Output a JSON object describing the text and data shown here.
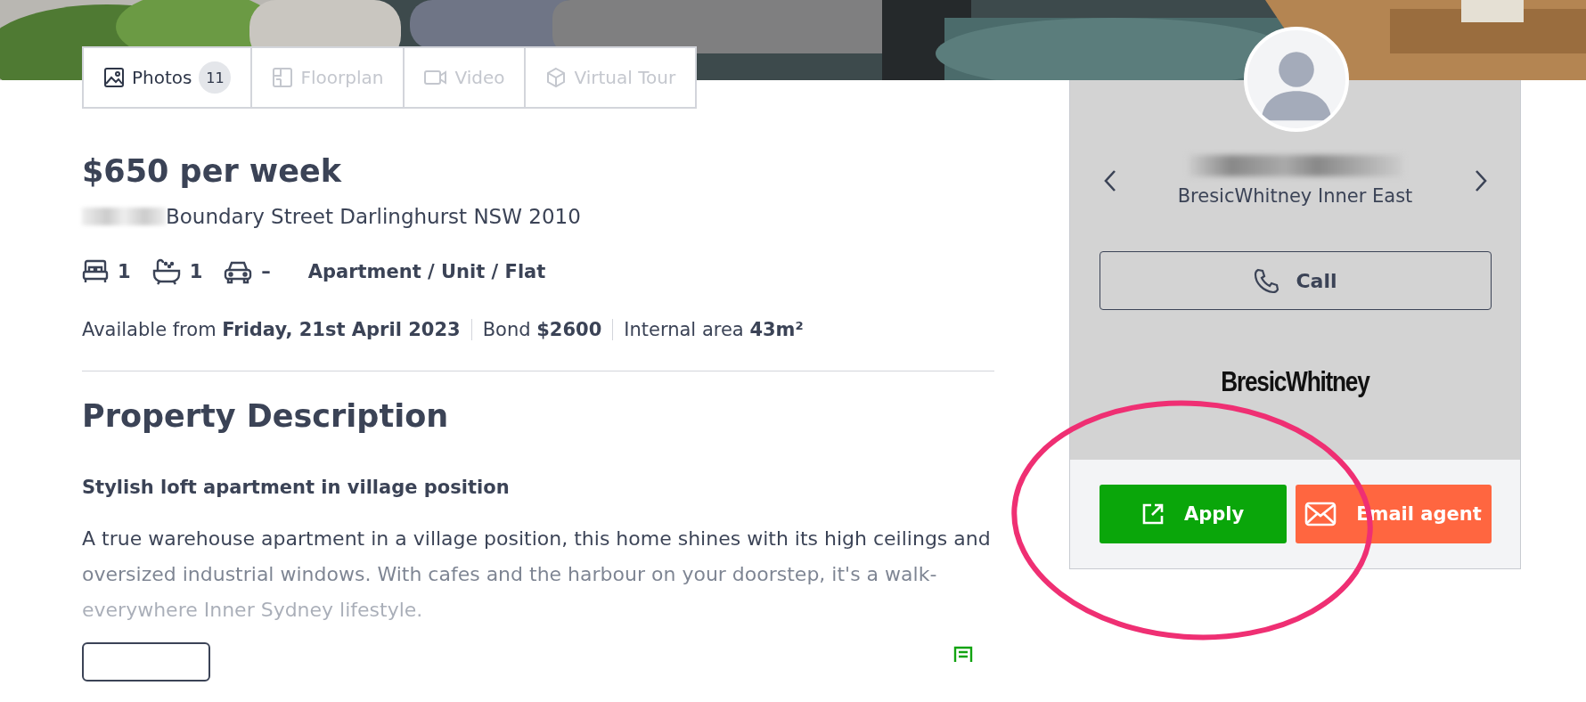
{
  "gallery_tabs": [
    {
      "label": "Photos",
      "count": "11",
      "kind": "photos",
      "selected": true,
      "disabled": false
    },
    {
      "label": "Floorplan",
      "kind": "floorplan",
      "selected": false,
      "disabled": true
    },
    {
      "label": "Video",
      "kind": "video",
      "selected": false,
      "disabled": true
    },
    {
      "label": "Virtual Tour",
      "kind": "tour",
      "selected": false,
      "disabled": true
    }
  ],
  "listing": {
    "price": "$650 per week",
    "address": "Boundary Street Darlinghurst NSW 2010",
    "features": [
      {
        "kind": "bed",
        "value": "1"
      },
      {
        "kind": "bath",
        "value": "1"
      },
      {
        "kind": "car",
        "value": "–"
      }
    ],
    "property_type": "Apartment / Unit / Flat",
    "facts": [
      "Available from **Friday, 21st April 2023**",
      "Bond **$2600**",
      "Internal area **43m²**"
    ]
  },
  "description": {
    "heading": "Property Description",
    "subtitle": "Stylish loft apartment in village position",
    "text": "A true warehouse apartment in a village position, this home shines with its high ceilings and oversized industrial windows. With cafes and the harbour on your doorstep, it's a walk-everywhere Inner Sydney lifestyle."
  },
  "agent": {
    "agency": "BresicWhitney Inner East",
    "call_label": "Call",
    "logo": "BresicWhitney",
    "actions": [
      {
        "kind": "apply",
        "label": "Apply"
      },
      {
        "kind": "email",
        "label": "Email agent"
      }
    ]
  }
}
